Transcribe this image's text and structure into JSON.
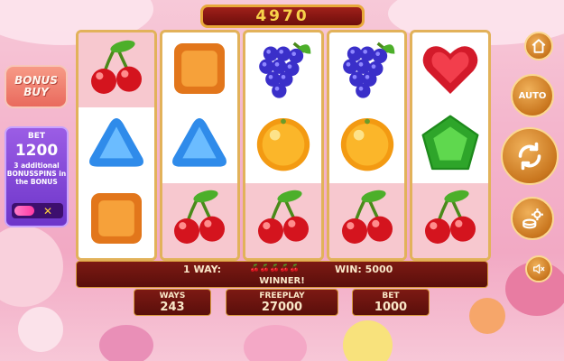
{
  "top_win_display": "4970",
  "bonus_buy": {
    "line1": "BONUS",
    "line2": "BUY"
  },
  "bet_panel": {
    "label": "BET",
    "value": "1200",
    "description": "3 additional BONUSSPINS in the BONUS",
    "toggle_icon": "close-x"
  },
  "right_buttons": [
    {
      "name": "home-icon"
    },
    {
      "name": "auto-button",
      "label": "AUTO"
    },
    {
      "name": "spin-icon"
    },
    {
      "name": "settings-coins-icon"
    },
    {
      "name": "sound-muted-icon"
    }
  ],
  "reels": [
    [
      "cherry",
      "blue-triangle",
      "orange-square"
    ],
    [
      "orange-square",
      "blue-triangle",
      "cherry"
    ],
    [
      "grapes",
      "orange",
      "cherry"
    ],
    [
      "grapes",
      "orange",
      "cherry"
    ],
    [
      "heart",
      "green-pentagon",
      "cherry"
    ]
  ],
  "winning_cells": [
    [
      0,
      0
    ],
    [
      1,
      2
    ],
    [
      2,
      2
    ],
    [
      3,
      2
    ],
    [
      4,
      2
    ]
  ],
  "info_bar": {
    "ways_label": "1 WAY:",
    "win_text": "WIN: 5000",
    "winner": "WINNER!",
    "mini_symbols": [
      "cherry",
      "cherry",
      "cherry",
      "cherry",
      "cherry"
    ]
  },
  "stats": {
    "ways": {
      "label": "WAYS",
      "value": "243"
    },
    "freeplay": {
      "label": "FREEPLAY",
      "value": "27000"
    },
    "bet": {
      "label": "BET",
      "value": "1000"
    }
  },
  "colors": {
    "frame_gold": "#e2b25a",
    "panel_red": "#7c1913",
    "win_highlight": "#f7c8cf",
    "bet_purple": "#7d44d6",
    "button_orange": "#d9862a"
  }
}
